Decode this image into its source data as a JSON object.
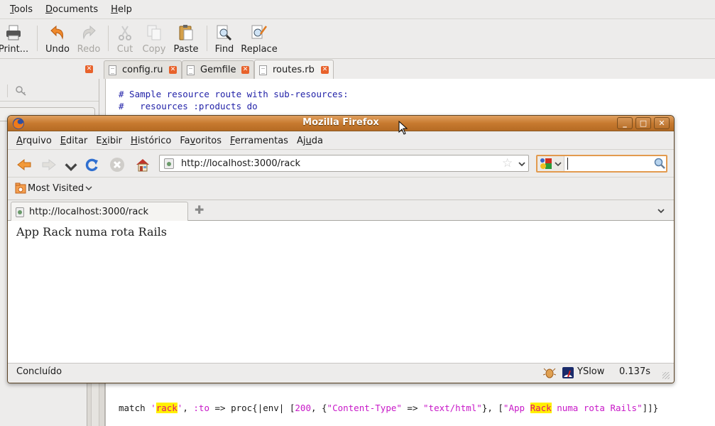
{
  "gedit": {
    "menu": [
      {
        "label": "Tools",
        "mnemonic": "T",
        "rest": "ools"
      },
      {
        "label": "Documents",
        "mnemonic": "D",
        "rest": "ocuments"
      },
      {
        "label": "Help",
        "mnemonic": "H",
        "rest": "elp"
      }
    ],
    "toolbar": {
      "print": "Print...",
      "undo": "Undo",
      "redo": "Redo",
      "cut": "Cut",
      "copy": "Copy",
      "paste": "Paste",
      "find": "Find",
      "replace": "Replace"
    },
    "tabs": [
      {
        "label": "config.ru"
      },
      {
        "label": "Gemfile"
      },
      {
        "label": "routes.rb",
        "active": true
      }
    ],
    "code": {
      "line1": "# Sample resource route with sub-resources:",
      "line2": "#   resources :products do",
      "match": {
        "kw": "match ",
        "q1": "'",
        "rack": "rack",
        "q2": "'",
        "comma": ", ",
        "sym": ":to",
        "arrow": " => proc{|env| [",
        "num": "200",
        "mid": ", {",
        "ct": "\"Content-Type\"",
        "arrow2": " => ",
        "th": "\"text/html\"",
        "mid2": "}, [",
        "app": "\"App ",
        "Rack": "Rack",
        "rest": " numa rota Rails\"",
        "end": "]]}"
      }
    }
  },
  "firefox": {
    "title": "Mozilla Firefox",
    "menu": [
      {
        "pre": "",
        "mn": "A",
        "post": "rquivo"
      },
      {
        "pre": "",
        "mn": "E",
        "post": "ditar"
      },
      {
        "pre": "E",
        "mn": "x",
        "post": "ibir"
      },
      {
        "pre": "",
        "mn": "H",
        "post": "istórico"
      },
      {
        "pre": "Fa",
        "mn": "v",
        "post": "oritos"
      },
      {
        "pre": "",
        "mn": "F",
        "post": "erramentas"
      },
      {
        "pre": "Aj",
        "mn": "u",
        "post": "da"
      }
    ],
    "url": "http://localhost:3000/rack",
    "search_value": "",
    "bookmarks": {
      "most_visited": "Most Visited"
    },
    "tab": {
      "title": "http://localhost:3000/rack"
    },
    "page": {
      "heading": "App Rack numa rota Rails"
    },
    "status": {
      "text": "Concluído",
      "yslow": "YSlow",
      "time": "0.137s"
    }
  }
}
